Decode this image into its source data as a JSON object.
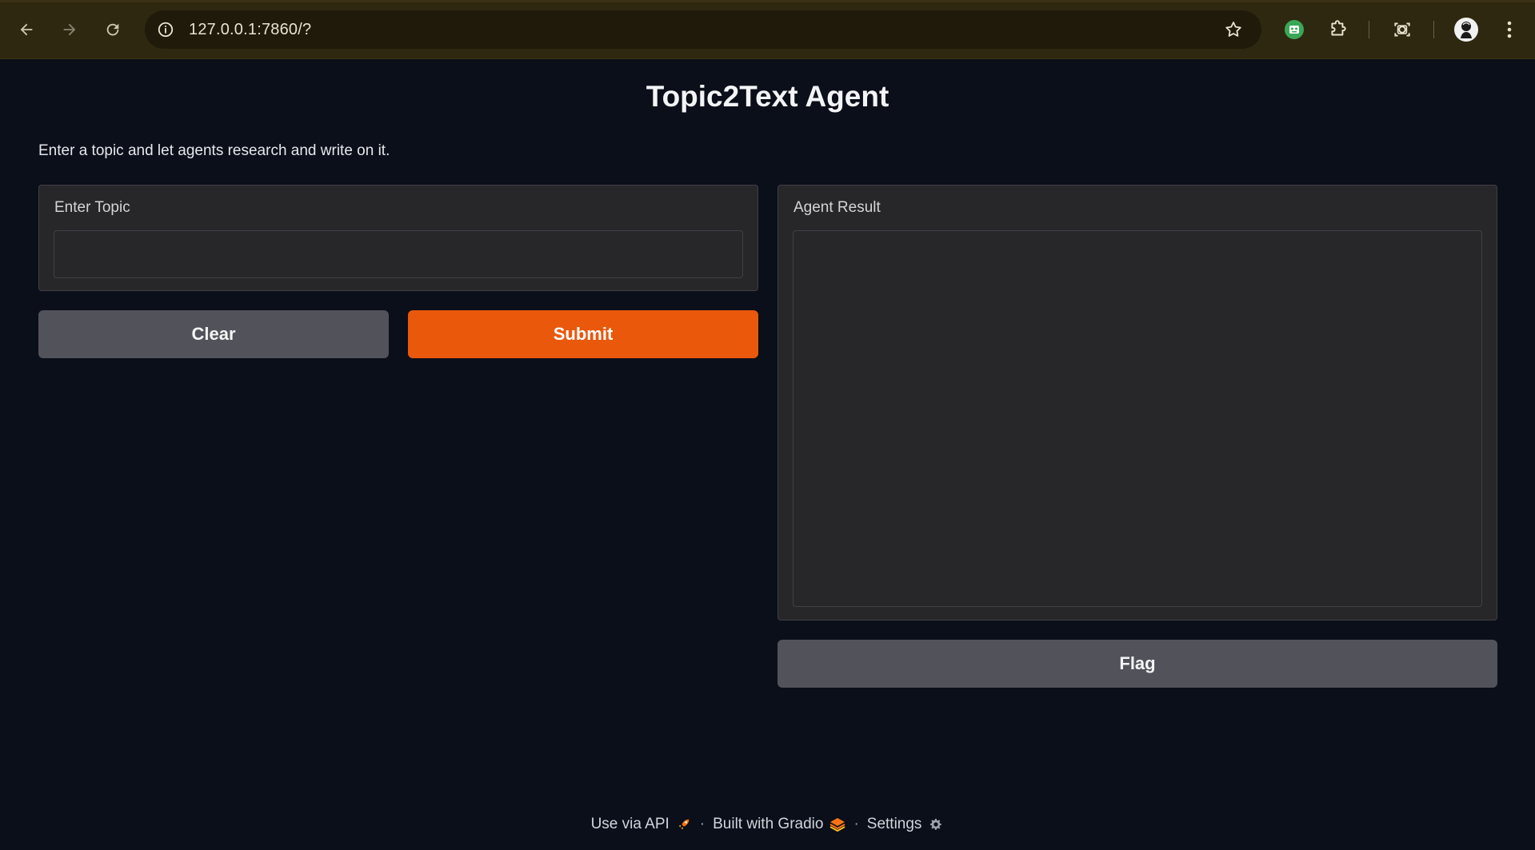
{
  "browser": {
    "url": "127.0.0.1:7860/?",
    "icons": [
      "back-icon",
      "forward-icon",
      "reload-icon",
      "site-info-icon",
      "bookmark-star-icon",
      "extension-robot-icon",
      "extensions-puzzle-icon",
      "screenshot-icon",
      "profile-avatar",
      "menu-kebab-icon"
    ]
  },
  "app": {
    "title": "Topic2Text Agent",
    "description": "Enter a topic and let agents research and write on it."
  },
  "input_panel": {
    "label": "Enter Topic",
    "value": "",
    "placeholder": ""
  },
  "buttons": {
    "clear": "Clear",
    "submit": "Submit",
    "flag": "Flag"
  },
  "output_panel": {
    "label": "Agent Result",
    "value": ""
  },
  "footer": {
    "api_label": "Use via API",
    "separator": "·",
    "gradio_label": "Built with Gradio",
    "settings_label": "Settings"
  },
  "colors": {
    "primary": "#ea580c",
    "secondary": "#52525b",
    "background": "#0b0f19",
    "panel": "#27272a",
    "browser_bar": "#2e2810"
  }
}
